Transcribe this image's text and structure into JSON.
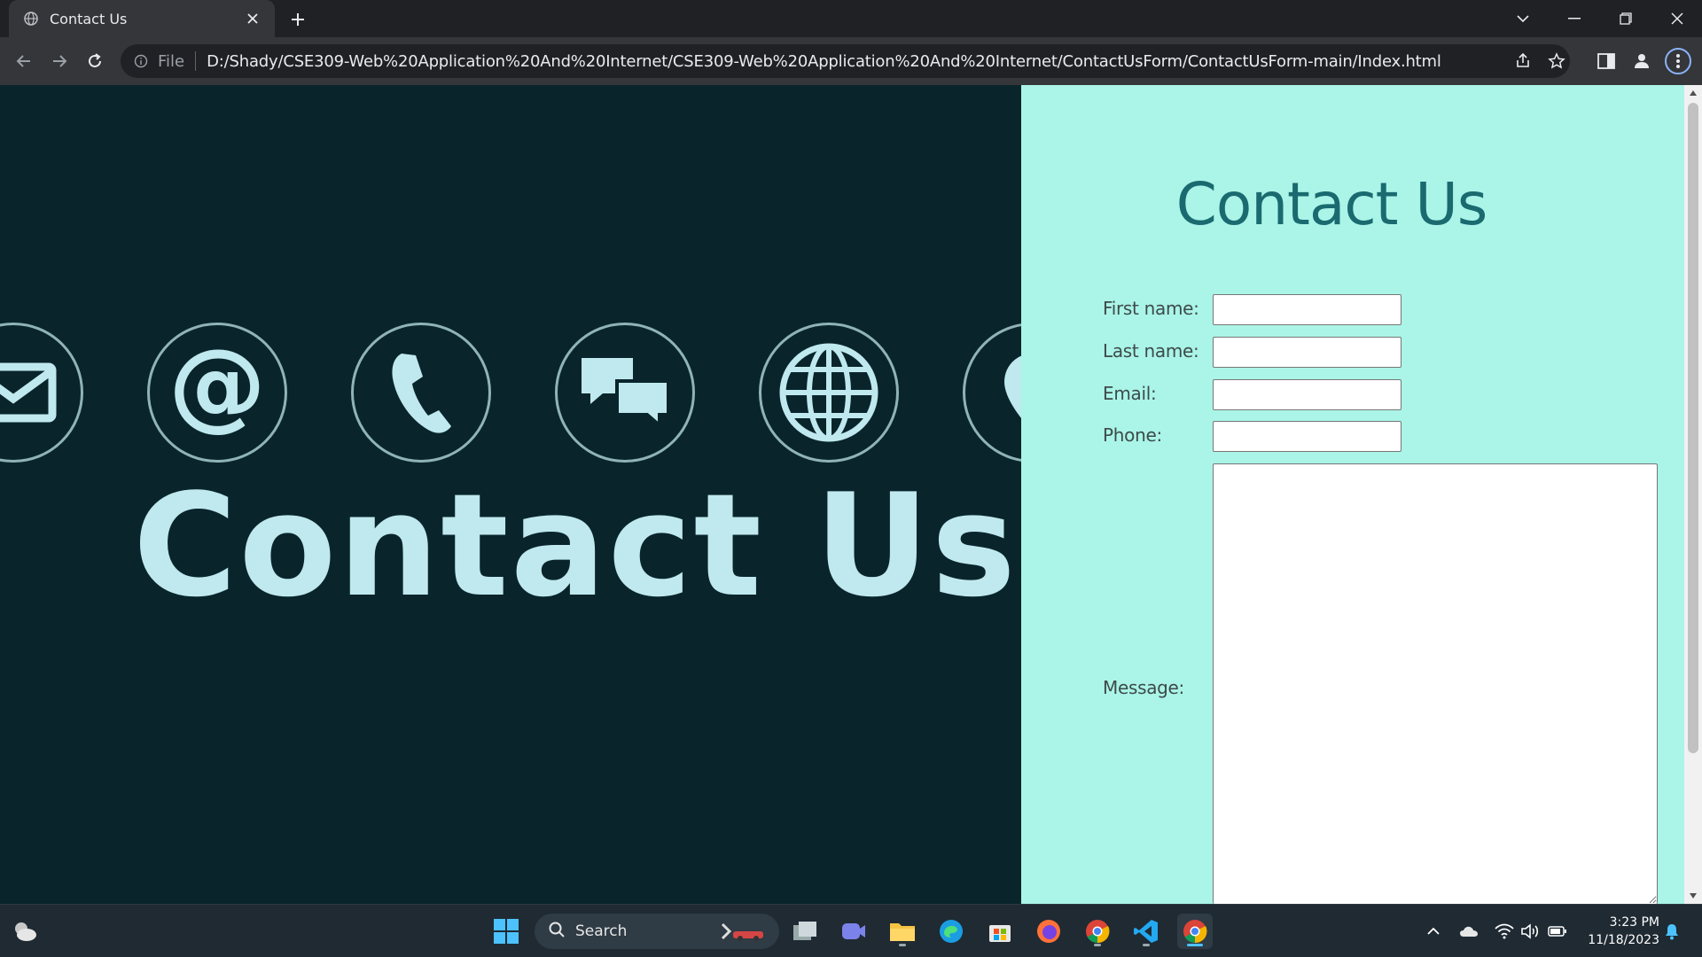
{
  "browser": {
    "tab": {
      "title": "Contact Us"
    },
    "address": {
      "scheme": "File",
      "url": "D:/Shady/CSE309-Web%20Application%20And%20Internet/CSE309-Web%20Application%20And%20Internet/ContactUsForm/ContactUsForm-main/Index.html"
    }
  },
  "hero": {
    "title": "Contact Us"
  },
  "form": {
    "title": "Contact Us",
    "fields": [
      {
        "label": "First name:",
        "value": ""
      },
      {
        "label": "Last name:",
        "value": ""
      },
      {
        "label": "Email:",
        "value": ""
      },
      {
        "label": "Phone:",
        "value": ""
      }
    ],
    "message_label": "Message:"
  },
  "taskbar": {
    "search_label": "Search",
    "clock": {
      "time": "3:23 PM",
      "date": "11/18/2023"
    }
  },
  "colors": {
    "hero_bg": "#09252b",
    "form_bg": "#aaf5e8",
    "title_color": "#1a6a70",
    "hero_text": "#bfe9ee"
  }
}
